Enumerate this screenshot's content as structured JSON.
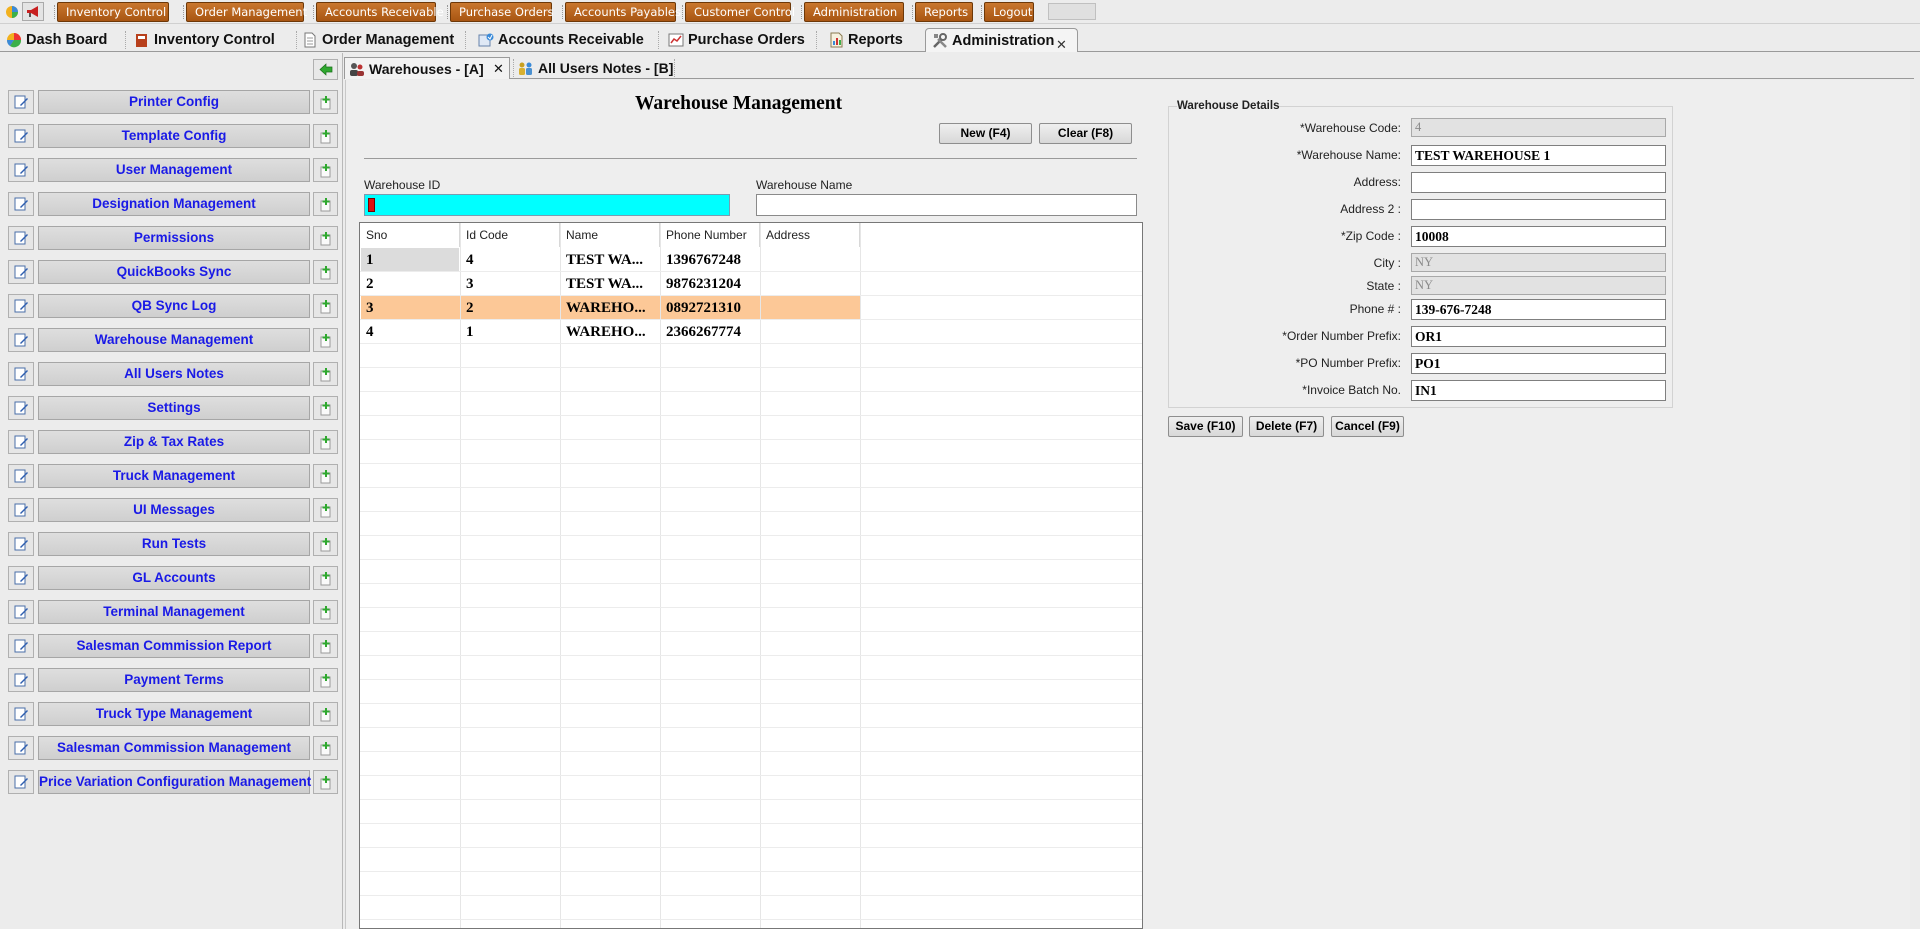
{
  "topbar": {
    "buttons": [
      "Inventory Control",
      "Order Management",
      "Accounts Receivable",
      "Purchase Orders",
      "Accounts Payables",
      "Customer Control",
      "Administration",
      "Reports",
      "Logout"
    ],
    "icons": [
      "app-logo-icon",
      "megaphone-icon"
    ]
  },
  "module_tabs": [
    {
      "label": "Dash Board",
      "icon": "pie-chart-icon"
    },
    {
      "label": "Inventory Control",
      "icon": "book-icon"
    },
    {
      "label": "Order Management",
      "icon": "document-icon"
    },
    {
      "label": "Accounts Receivable",
      "icon": "receivable-icon"
    },
    {
      "label": "Purchase Orders",
      "icon": "purchase-chart-icon"
    },
    {
      "label": "Reports",
      "icon": "report-icon"
    },
    {
      "label": "Administration",
      "icon": "tools-icon",
      "active": true
    }
  ],
  "sidebar": {
    "items": [
      "Printer Config",
      "Template Config",
      "User Management",
      "Designation Management",
      "Permissions",
      "QuickBooks Sync",
      "QB Sync Log",
      "Warehouse Management",
      "All Users Notes",
      "Settings",
      "Zip & Tax Rates",
      "Truck Management",
      "UI Messages",
      "Run Tests",
      "GL Accounts",
      "Terminal Management",
      "Salesman Commission Report",
      "Payment Terms",
      "Truck Type Management",
      "Salesman Commission Management",
      "Price Variation Configuration Management"
    ]
  },
  "content_tabs": [
    {
      "label": "Warehouses - [A]",
      "icon": "users-icon",
      "active": true
    },
    {
      "label": "All Users Notes - [B]",
      "icon": "group-icon",
      "active": false
    }
  ],
  "main": {
    "title": "Warehouse Management",
    "new_label": "New (F4)",
    "clear_label": "Clear (F8)",
    "warehouse_id_label": "Warehouse ID",
    "warehouse_id_value": "",
    "warehouse_name_label": "Warehouse Name",
    "warehouse_name_value": ""
  },
  "grid": {
    "columns": [
      "Sno",
      "Id Code",
      "Name",
      "Phone Number",
      "Address"
    ],
    "rows": [
      [
        "1",
        "4",
        "TEST WA...",
        "1396767248",
        ""
      ],
      [
        "2",
        "3",
        "TEST WA...",
        "9876231204",
        ""
      ],
      [
        "3",
        "2",
        "WAREHO...",
        "0892721310",
        ""
      ],
      [
        "4",
        "1",
        "WAREHO...",
        "2366267774",
        ""
      ]
    ],
    "selected_row": 3,
    "selected_color": "#fcc897"
  },
  "details": {
    "title": "Warehouse Details",
    "fields": [
      {
        "label": "*Warehouse Code:",
        "value": "4",
        "disabled": true
      },
      {
        "label": "*Warehouse Name:",
        "value": "TEST WAREHOUSE 1",
        "disabled": false
      },
      {
        "label": "Address:",
        "value": "",
        "disabled": false
      },
      {
        "label": "Address 2 :",
        "value": "",
        "disabled": false
      },
      {
        "label": "*Zip Code :",
        "value": "10008",
        "disabled": false
      },
      {
        "label": "City :",
        "value": "NY",
        "disabled": true
      },
      {
        "label": "State :",
        "value": "NY",
        "disabled": true
      },
      {
        "label": "Phone # :",
        "value": "139-676-7248",
        "disabled": false
      },
      {
        "label": "*Order Number Prefix:",
        "value": "OR1",
        "disabled": false
      },
      {
        "label": "*PO Number Prefix:",
        "value": "PO1",
        "disabled": false
      },
      {
        "label": "*Invoice Batch No.",
        "value": "IN1",
        "disabled": false
      }
    ],
    "save_label": "Save (F10)",
    "delete_label": "Delete (F7)",
    "cancel_label": "Cancel (F9)"
  },
  "colors": {
    "accent": "#b8601c",
    "link_blue": "#1a1ae6",
    "id_field_bg": "#00ffff"
  }
}
